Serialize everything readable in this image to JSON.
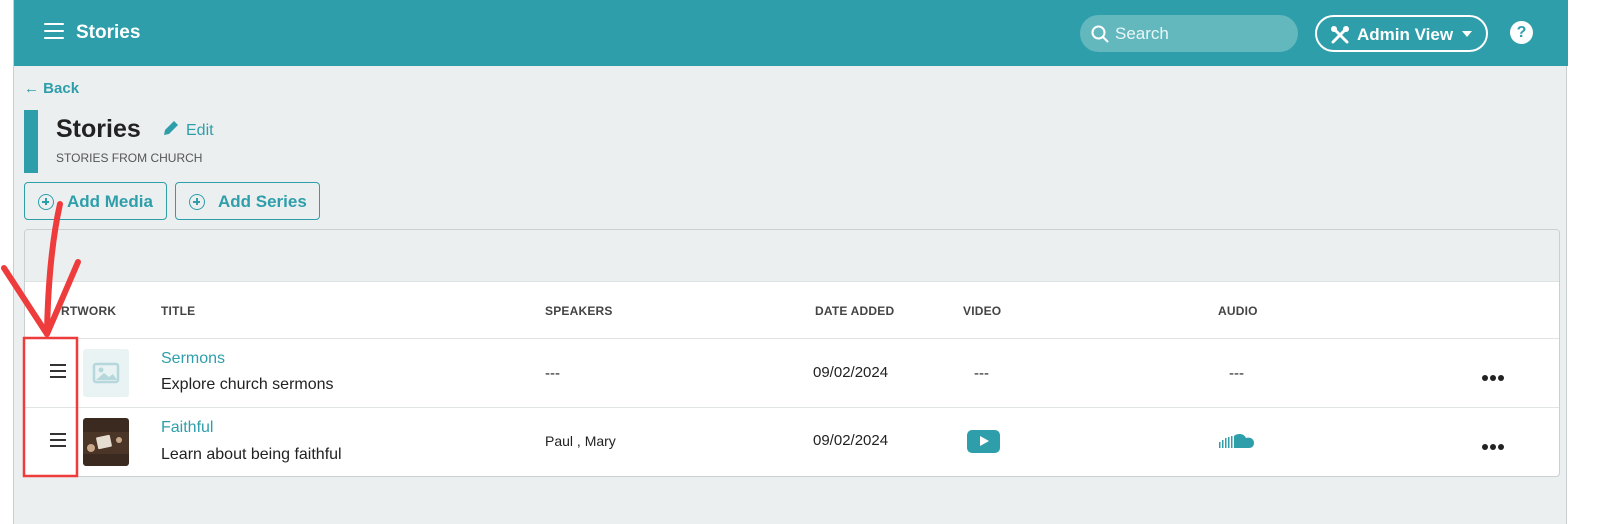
{
  "header": {
    "title": "Stories",
    "search_placeholder": "Search",
    "admin_label": "Admin View",
    "help_label": "?"
  },
  "nav": {
    "back_label": "Back"
  },
  "page": {
    "title": "Stories",
    "edit_label": "Edit",
    "subtitle": "STORIES FROM CHURCH"
  },
  "actions": {
    "add_media": "Add Media",
    "add_series": "Add Series"
  },
  "table": {
    "columns": {
      "artwork": "RTWORK",
      "title": "TITLE",
      "speakers": "SPEAKERS",
      "date_added": "DATE ADDED",
      "video": "VIDEO",
      "audio": "AUDIO"
    },
    "rows": [
      {
        "title": "Sermons",
        "description": "Explore church sermons",
        "speakers": "---",
        "date": "09/02/2024",
        "video": "---",
        "audio": "---"
      },
      {
        "title": "Faithful",
        "description": "Learn about being faithful",
        "speakers": "Paul , Mary",
        "date": "09/02/2024",
        "video_icon": "youtube-icon",
        "audio_icon": "soundcloud-icon"
      }
    ]
  },
  "colors": {
    "brand": "#2e9faa",
    "annotation": "#ee3b3b"
  }
}
